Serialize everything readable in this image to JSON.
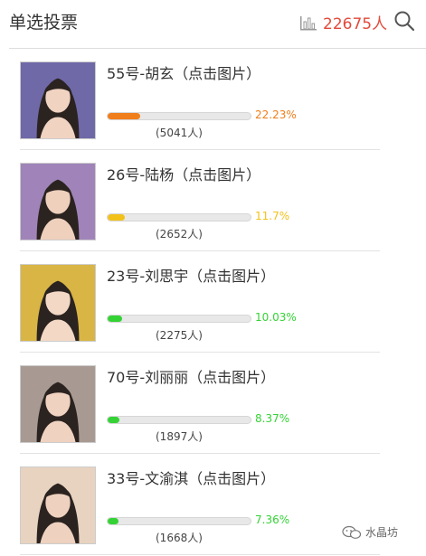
{
  "header": {
    "title": "单选投票",
    "total_count": "22675人",
    "icons": [
      "bar-chart-icon",
      "search-icon"
    ],
    "accent_color": "#e24a3b"
  },
  "candidates": [
    {
      "name": "55号-胡玄（点击图片）",
      "percent": "22.23%",
      "fraction": 0.2223,
      "votes": "(5041人)",
      "bar_color": "#f07e1a",
      "pct_color": "#f07e1a"
    },
    {
      "name": "26号-陆杨（点击图片）",
      "percent": "11.7%",
      "fraction": 0.117,
      "votes": "(2652人)",
      "bar_color": "#f2c21b",
      "pct_color": "#f2c21b"
    },
    {
      "name": "23号-刘思宇（点击图片）",
      "percent": "10.03%",
      "fraction": 0.1003,
      "votes": "(2275人)",
      "bar_color": "#35d236",
      "pct_color": "#35d236"
    },
    {
      "name": "70号-刘丽丽（点击图片）",
      "percent": "8.37%",
      "fraction": 0.0837,
      "votes": "(1897人)",
      "bar_color": "#35d236",
      "pct_color": "#35d236"
    },
    {
      "name": "33号-文渝淇（点击图片）",
      "percent": "7.36%",
      "fraction": 0.0736,
      "votes": "(1668人)",
      "bar_color": "#35d236",
      "pct_color": "#35d236"
    }
  ],
  "watermark": {
    "text": "水晶坊",
    "icon": "wechat-icon"
  }
}
